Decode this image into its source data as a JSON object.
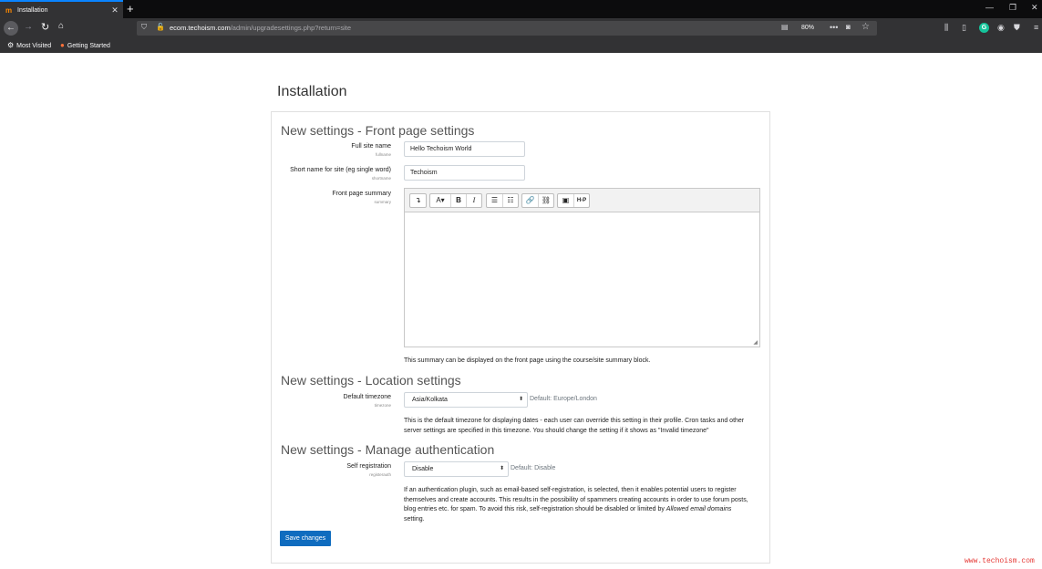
{
  "browser": {
    "tab_title": "Installation",
    "tab_favicon": "m",
    "tab_close": "✕",
    "new_tab": "+",
    "url_host": "ecom.techoism.com",
    "url_path": "/admin/upgradesettings.php?return=site",
    "zoom": "80%",
    "bookmarks": [
      {
        "label": "Most Visited",
        "icon": "gear-icon"
      },
      {
        "label": "Getting Started",
        "icon": "firefox-icon"
      }
    ],
    "accent_color": "#0a84ff"
  },
  "page": {
    "title": "Installation"
  },
  "front_page": {
    "heading": "New settings - Front page settings",
    "fullname": {
      "label": "Full site name",
      "key": "fullname",
      "value": "Hello Techoism World"
    },
    "shortname": {
      "label": "Short name for site (eg single word)",
      "key": "shortname",
      "value": "Techoism"
    },
    "summary": {
      "label": "Front page summary",
      "key": "summary",
      "value": "",
      "help": "This summary can be displayed on the front page using the course/site summary block."
    },
    "toolbar": {
      "toggle": "↴",
      "font": "A▾",
      "bold": "B",
      "italic": "I",
      "bullet_list": "☰",
      "numbered_list": "☷",
      "link": "🔗",
      "unlink": "⛓",
      "image": "▣",
      "h5p": "H-P"
    }
  },
  "location": {
    "heading": "New settings - Location settings",
    "label": "Default timezone",
    "key": "timezone",
    "value": "Asia/Kolkata",
    "default": "Default: Europe/London",
    "help_lines": [
      "This is the default timezone for displaying dates - each user can override this setting in their profile. Cron tasks and other",
      "server settings are specified in this timezone. You should change the setting if it shows as \"Invalid timezone\""
    ]
  },
  "auth": {
    "heading": "New settings - Manage authentication",
    "label": "Self registration",
    "key": "registerauth",
    "value": "Disable",
    "default": "Default: Disable",
    "help_lines": [
      "If an authentication plugin, such as email-based self-registration, is selected, then it enables potential users to register",
      "themselves and create accounts. This results in the possibility of spammers creating accounts in order to use forum posts,",
      "blog entries etc. for spam. To avoid this risk, self-registration should be disabled or limited by"
    ],
    "help_em": "Allowed email domains",
    "help_last": "setting."
  },
  "save_label": "Save changes",
  "primary_color": "#0f6cbf",
  "watermark": "www.techoism.com"
}
